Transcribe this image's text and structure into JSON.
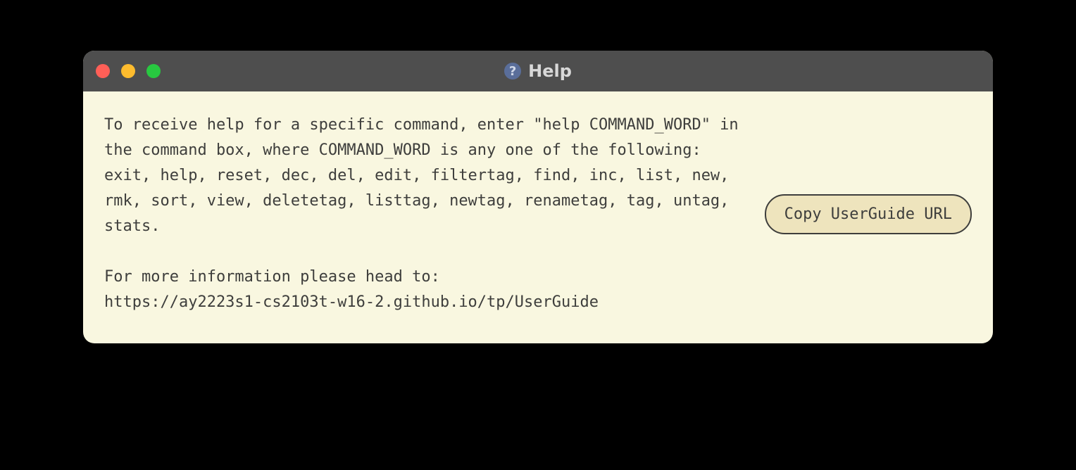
{
  "window": {
    "title": "Help",
    "icon_name": "help-icon"
  },
  "help": {
    "body": "To receive help for a specific command, enter \"help COMMAND_WORD\" in the command box, where COMMAND_WORD is any one of the following:\nexit, help, reset, dec, del, edit, filtertag, find, inc, list, new, rmk, sort, view, deletetag, listtag, newtag, renametag, tag, untag, stats.\n\nFor more information please head to:\nhttps://ay2223s1-cs2103t-w16-2.github.io/tp/UserGuide",
    "copy_button_label": "Copy UserGuide URL"
  },
  "traffic_lights": {
    "close": "#ff5f57",
    "minimize": "#febc2e",
    "zoom": "#28c840"
  }
}
